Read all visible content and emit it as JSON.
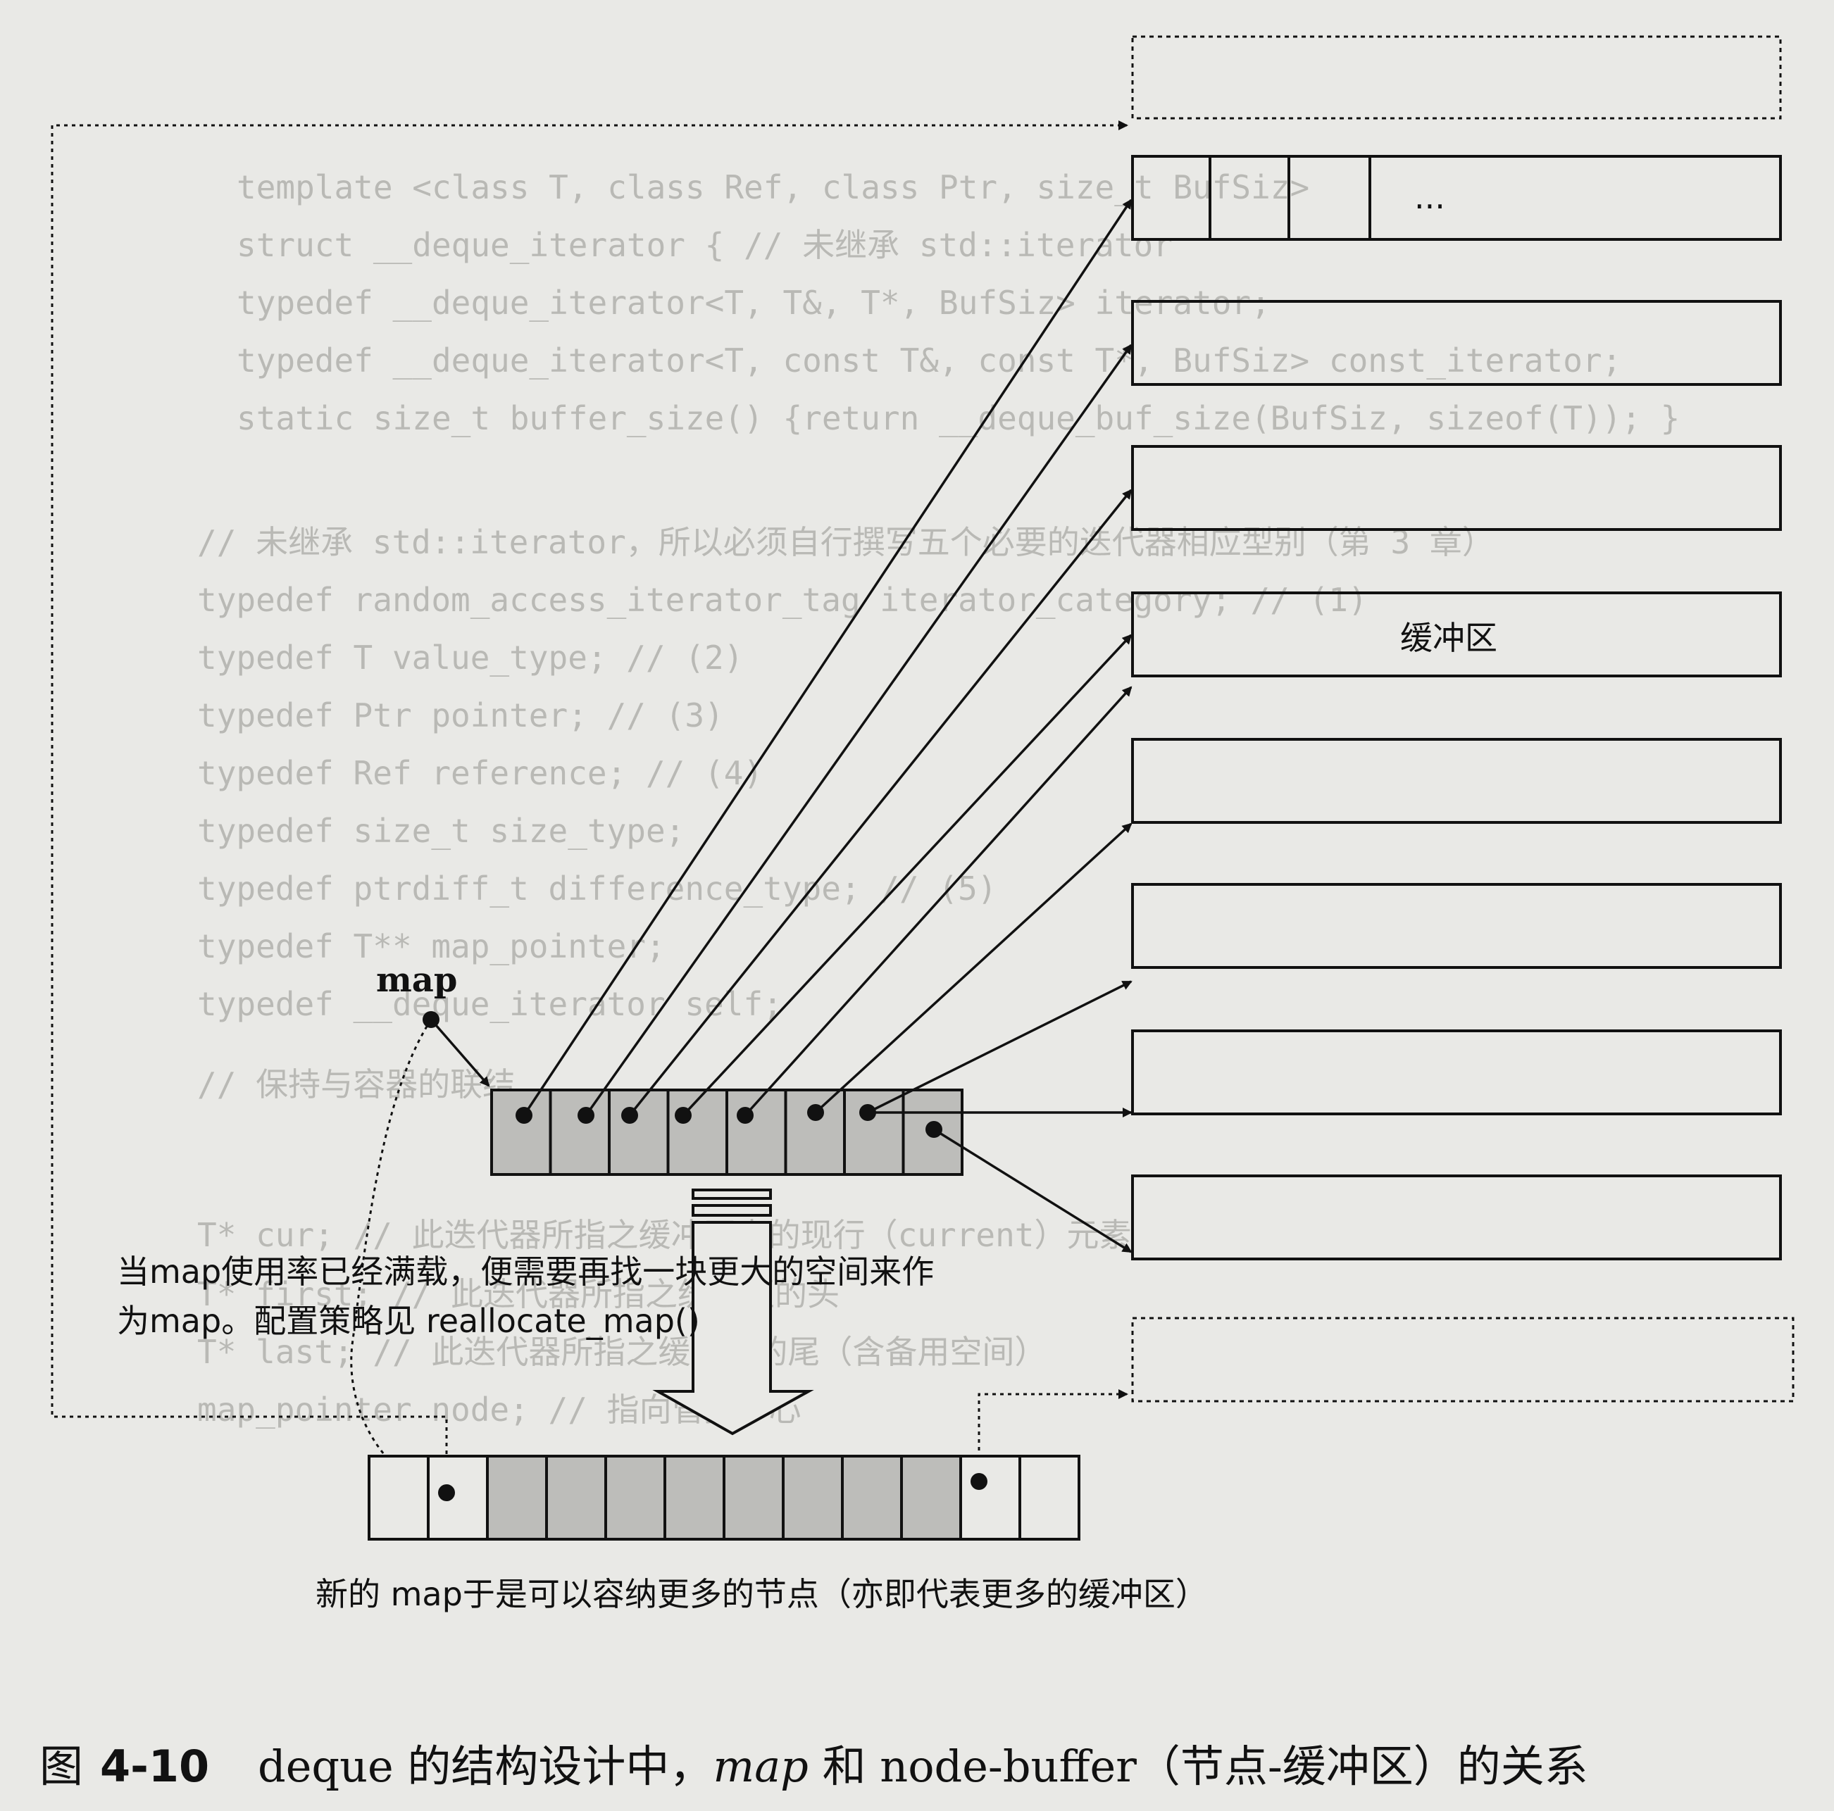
{
  "background_text": [
    "template <class T, class Ref, class Ptr, size_t BufSiz>",
    "struct __deque_iterator { // 未继承 std::iterator",
    "typedef __deque_iterator<T, T&, T*, BufSiz>      iterator;",
    "typedef __deque_iterator<T, const T&, const T*, BufSiz> const_iterator;",
    "static size_t buffer_size() {return __deque_buf_size(BufSiz, sizeof(T)); }",
    "// 未继承 std::iterator，所以必须自行撰写五个必要的迭代器相应型别（第 3 章）",
    "typedef random_access_iterator_tag iterator_category; // (1)",
    "typedef T value_type;           // (2)",
    "typedef Ptr pointer;            // (3)",
    "typedef Ref reference;          // (4)",
    "typedef size_t size_type;",
    "typedef ptrdiff_t difference_type; // (5)",
    "typedef T** map_pointer;",
    "typedef __deque_iterator self;",
    "// 保持与容器的联结",
    "T* cur;    // 此迭代器所指之缓冲区中的现行（current）元素",
    "T* first;  // 此迭代器所指之缓冲区的头",
    "T* last;   // 此迭代器所指之缓冲区的尾（含备用空间）",
    "map_pointer node;  // 指向管控中心"
  ],
  "diagram": {
    "map_label": "map",
    "buffer_label": "缓冲区",
    "ellipsis": "...",
    "old_map_cells": 8,
    "new_map_cells": 12,
    "note_line1": "当map使用率已经满载，便需要再找一块更大的空间来作",
    "note_line2": "为map。配置策略见 reallocate_map()",
    "bottom_note": "新的 map于是可以容纳更多的节点（亦即代表更多的缓冲区）"
  },
  "caption": {
    "prefix": "图",
    "number": "4-10",
    "text_a": "deque 的结构设计中，",
    "text_map": "map",
    "text_b": " 和 node-buffer（节点-缓冲区）的关系"
  },
  "colors": {
    "ink": "#111111",
    "shaded_cell": "#bdbdba",
    "faded_text": "#b9b9b5",
    "paper": "#e9e9e6"
  }
}
